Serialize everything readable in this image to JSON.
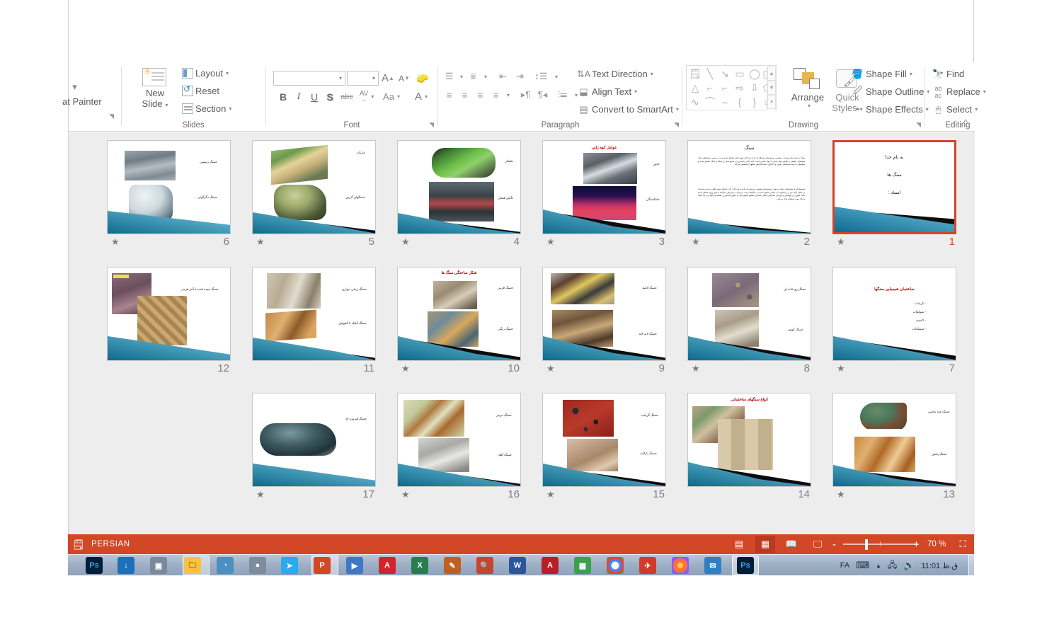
{
  "ribbon": {
    "groups": [
      {
        "name": "clipboard",
        "label": ""
      },
      {
        "name": "slides",
        "label": "Slides"
      },
      {
        "name": "font",
        "label": "Font"
      },
      {
        "name": "paragraph",
        "label": "Paragraph"
      },
      {
        "name": "drawing",
        "label": "Drawing"
      },
      {
        "name": "editing",
        "label": "Editing"
      }
    ],
    "clipboard": {
      "format_painter": "at Painter"
    },
    "slides": {
      "new_slide": "New",
      "new_slide_2": "Slide",
      "layout": "Layout",
      "reset": "Reset",
      "section": "Section",
      "label": "Slides"
    },
    "font": {
      "font_name_value": "",
      "font_size_value": "",
      "grow_font": "A",
      "shrink_font": "A",
      "clear_formatting": "clear-format",
      "bold": "B",
      "italic": "I",
      "underline": "U",
      "shadow": "S",
      "strikethrough": "abc",
      "char_spacing": "AV",
      "change_case": "Aa",
      "font_color": "A",
      "label": "Font"
    },
    "paragraph": {
      "text_direction": "Text Direction",
      "align_text": "Align Text",
      "convert_to_smartart": "Convert to SmartArt",
      "label": "Paragraph"
    },
    "drawing": {
      "arrange": "Arrange",
      "quick": "Quick",
      "styles": "Styles",
      "shape_fill": "Shape Fill",
      "shape_outline": "Shape Outline",
      "shape_effects": "Shape Effects",
      "label": "Drawing"
    },
    "editing": {
      "find": "Find",
      "replace": "Replace",
      "select": "Select",
      "label": "Editing"
    },
    "collapse_ribbon": "^"
  },
  "slides_pane": {
    "slides": [
      {
        "number": "6",
        "starred": true,
        "selected": false,
        "bullets": [
          "سنگ رسوبی",
          "سنگ دگرگونی"
        ],
        "title": "",
        "title_color": ""
      },
      {
        "number": "5",
        "starred": true,
        "selected": false,
        "bullets": [
          "زلزله",
          "سنگهای آذرین"
        ],
        "title": "",
        "title_color": ""
      },
      {
        "number": "4",
        "starred": true,
        "selected": false,
        "bullets": [
          "فشار",
          "آتش فشان"
        ],
        "title": "",
        "title_color": ""
      },
      {
        "number": "3",
        "starred": true,
        "selected": false,
        "title": "عوامل کوه زایی",
        "title_color": "#c00000",
        "bullets": [
          "چین",
          "شکستگی"
        ]
      },
      {
        "number": "2",
        "starred": true,
        "selected": false,
        "title": "سنگ",
        "title_color": "#1a1a1a",
        "paragraphs": [
          "سنگ به ماده جامد وسخت و طبیعی مجموعه‌ای متشکل از یک یا چند کانی پیوند یافته تشکیل شده است در بعضی بخش‌های سنگ شیشه‌ای، طبیعی و بقایای مواد سنتی یا مواد معدنی است. لایه خاکی جامدتری از مجموعه‌ای از سنگ و سنگ تشکیل شده و مخلوطی به تود‌ه مستحکم رسوبی و دگرگون عمدتا شاخص سنگها را مشخص می‌کند.",
          "مجموعه‌ای از بخش‌هایی سنگ به مواد و مجموعه‌ای طبیعی می‌شود که جامد یا چند کانی که با یکدیگر پیوند یافته و درست شده‌اند در شکل خاک نرم و بی‌مقاومت از عناصر تشکیل شده در سنگ‌ها درست می‌شود. در فیزیکی سنگ‌ها به طور ویژه تشکیل شده است لیتوژن در مهندسی و کاردانی ساختمان کاملی مقداری مصالح مجموعه‌ای به عنوان شاخص در طبقه‌بندی آنها و در یک سنگ و خاک مورد استفاده قرار می‌گیرد."
        ]
      },
      {
        "number": "1",
        "starred": true,
        "selected": true,
        "lines": [
          "به نام خدا",
          "سنگ ها",
          "استاد :"
        ]
      },
      {
        "number": "12",
        "starred": false,
        "selected": false,
        "bullets": [
          "سنگ چیده شده با آجر قرمز"
        ],
        "title": "",
        "title_color": ""
      },
      {
        "number": "11",
        "starred": false,
        "selected": false,
        "bullets": [
          "سنگ زینتی دیواری",
          "سنگ آنتیک با کفپوش"
        ],
        "title": "",
        "title_color": ""
      },
      {
        "number": "10",
        "starred": true,
        "selected": false,
        "title": "شکل ساختگی سنگ ها",
        "title_color": "#c00000",
        "bullets": [
          "سنگ قرنیز",
          "سنگ رنگی"
        ]
      },
      {
        "number": "9",
        "starred": true,
        "selected": false,
        "bullets": [
          "سنگ لاشه",
          "سنگ لایه لایه"
        ],
        "title": "",
        "title_color": ""
      },
      {
        "number": "8",
        "starred": true,
        "selected": false,
        "bullets": [
          "سنگ رودخانه ای",
          "سنگ کوهی"
        ],
        "title": "",
        "title_color": ""
      },
      {
        "number": "7",
        "starred": true,
        "selected": false,
        "title": "ساختمان شیمیایی سنگها",
        "title_color": "#c00000",
        "list": [
          "- کربنات",
          "- سولفات",
          "- اکسید",
          "- سیلیکات"
        ]
      },
      {
        "number": "17",
        "starred": true,
        "selected": false,
        "bullets": [
          "سنگ فیروزه ای"
        ],
        "title": "",
        "title_color": ""
      },
      {
        "number": "16",
        "starred": true,
        "selected": false,
        "bullets": [
          "سنگ مرمر",
          "سنگ آهک"
        ],
        "title": "",
        "title_color": ""
      },
      {
        "number": "15",
        "starred": true,
        "selected": false,
        "bullets": [
          "سنگ گرانیت",
          "سنگ بازالت"
        ],
        "title": "",
        "title_color": ""
      },
      {
        "number": "14",
        "starred": false,
        "selected": false,
        "title": "انواع سنگهای ساختمانی",
        "title_color": "#c00000",
        "bullets": []
      },
      {
        "number": "13",
        "starred": true,
        "selected": false,
        "bullets": [
          "سنگ چند بخشی",
          "سنگ پخش"
        ],
        "title": "",
        "title_color": ""
      }
    ]
  },
  "status_bar": {
    "language": "PERSIAN",
    "notes_icon": "notes-icon",
    "zoom_out": "-",
    "zoom_in": "+",
    "zoom_level": "70 %",
    "fit_slide": "fit-to-window-icon",
    "views": [
      "normal-view",
      "slide-sorter-view",
      "reading-view",
      "slideshow-view"
    ]
  },
  "taskbar": {
    "apps": [
      {
        "name": "photoshop",
        "label": "Ps",
        "color": "#001e36",
        "text": "#31a8ff"
      },
      {
        "name": "internet-download-manager",
        "label": "↓",
        "color": "#1d6fb8",
        "text": "#ffffff"
      },
      {
        "name": "camera-app",
        "label": "▣",
        "color": "#7a8a99",
        "text": "#ffffff"
      },
      {
        "name": "file-explorer",
        "label": "🗀",
        "color": "#f7c33e",
        "text": "#8a6a00"
      },
      {
        "name": "antivirus",
        "label": "◔",
        "color": "#4a90c2",
        "text": "#ffffff"
      },
      {
        "name": "browser-old",
        "label": "●",
        "color": "#7f8c9b",
        "text": "#ffffff"
      },
      {
        "name": "telegram",
        "label": "➤",
        "color": "#2aabee",
        "text": "#ffffff"
      },
      {
        "name": "powerpoint",
        "label": "P",
        "color": "#d24726",
        "text": "#ffffff"
      },
      {
        "name": "media-player",
        "label": "▶",
        "color": "#3f78c4",
        "text": "#ffffff"
      },
      {
        "name": "acrobat-reader",
        "label": "A",
        "color": "#d3242b",
        "text": "#ffffff"
      },
      {
        "name": "excel",
        "label": "X",
        "color": "#2a7d4f",
        "text": "#ffffff"
      },
      {
        "name": "paint-tool",
        "label": "✎",
        "color": "#c06020",
        "text": "#ffffff"
      },
      {
        "name": "search-tool",
        "label": "🔍",
        "color": "#c8442a",
        "text": "#ffffff"
      },
      {
        "name": "word",
        "label": "W",
        "color": "#2b579a",
        "text": "#ffffff"
      },
      {
        "name": "autocad",
        "label": "A",
        "color": "#b81f24",
        "text": "#ffffff"
      },
      {
        "name": "statistics-app",
        "label": "▦",
        "color": "#3f9f4f",
        "text": "#ffffff"
      },
      {
        "name": "chrome",
        "label": "●",
        "color": "#ffffff",
        "text": "#4285f4"
      },
      {
        "name": "gaming-app",
        "label": "✈",
        "color": "#d33a2c",
        "text": "#ffffff"
      },
      {
        "name": "firefox",
        "label": "●",
        "color": "#ff7139",
        "text": "#ffffff"
      },
      {
        "name": "mail-client",
        "label": "✉",
        "color": "#2f7fc1",
        "text": "#ffffff"
      },
      {
        "name": "photoshop-2",
        "label": "Ps",
        "color": "#001e36",
        "text": "#31a8ff"
      }
    ],
    "tray": {
      "language": "FA",
      "keyboard_icon": "keyboard-icon",
      "show_hidden_icon": "chevron-up-icon",
      "network_icon": "network-icon",
      "volume_icon": "speaker-icon",
      "clock": "11:01 ق.ظ"
    }
  }
}
